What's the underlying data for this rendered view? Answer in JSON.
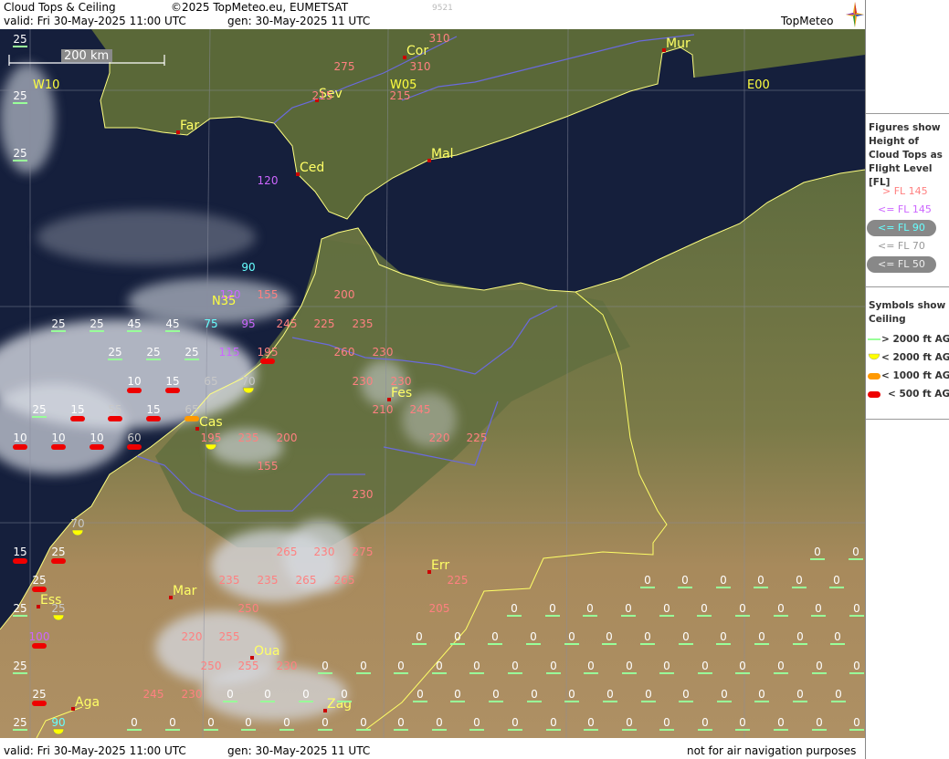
{
  "header": {
    "title": "Cloud Tops & Ceiling",
    "copyright": "©2025 TopMeteo.eu, EUMETSAT",
    "code": "9521",
    "valid": "valid:  Fri  30-May-2025  11:00 UTC",
    "gen": "gen: 30-May-2025 11 UTC",
    "logo": "TopMeteo"
  },
  "footer": {
    "valid": "valid:  Fri  30-May-2025  11:00 UTC",
    "gen": "gen: 30-May-2025 11 UTC",
    "disclaimer": "not for air navigation purposes"
  },
  "scale_label": "200 km",
  "grid_labels": {
    "w10": "W10",
    "w05": "W05",
    "e00": "E00",
    "n35": "N35"
  },
  "legend": {
    "figures_title": "Figures show Height of Cloud Tops as Flight Level [FL]",
    "items": [
      {
        "label": "> FL 145",
        "color": "#ff8080",
        "pill": false
      },
      {
        "label": "<= FL 145",
        "color": "#cc66ff",
        "pill": false
      },
      {
        "label": "<= FL 90",
        "color": "#66ffff",
        "pill": true
      },
      {
        "label": "<= FL 70",
        "color": "#999999",
        "pill": false
      },
      {
        "label": "<= FL 50",
        "color": "#eeeeee",
        "pill": true
      }
    ],
    "symbols_title": "Symbols show Ceiling",
    "symbols": [
      {
        "label": "> 2000 ft AGL",
        "type": "line",
        "color": "#99ff99"
      },
      {
        "label": "< 2000 ft AGL",
        "type": "half",
        "color": "#ffff00"
      },
      {
        "label": "< 1000 ft AGL",
        "type": "bar",
        "color": "#ff9900"
      },
      {
        "label": "< 500 ft AGL",
        "type": "bar",
        "color": "#ee0000"
      }
    ]
  },
  "colors": {
    "sea": "#141e3a",
    "land_n": "#5d6a3c",
    "land_s": "#a88a5c",
    "coast": "#ffff80",
    "border": "#ffff66",
    "river": "#6a6adc"
  },
  "cities": [
    {
      "name": "Cor"
    },
    {
      "name": "Mur"
    },
    {
      "name": "Sev"
    },
    {
      "name": "Far"
    },
    {
      "name": "Mal"
    },
    {
      "name": "Ced"
    },
    {
      "name": "Fes"
    },
    {
      "name": "Cas"
    },
    {
      "name": "Err"
    },
    {
      "name": "Mar"
    },
    {
      "name": "Ess"
    },
    {
      "name": "Oua"
    },
    {
      "name": "Aga"
    },
    {
      "name": "Zag"
    }
  ],
  "readings": [
    {
      "v": "25",
      "c": "green"
    },
    {
      "v": "25",
      "c": "green"
    },
    {
      "v": "25",
      "c": "green"
    },
    {
      "v": "310",
      "c": "pink"
    },
    {
      "v": "275",
      "c": "pink"
    },
    {
      "v": "310",
      "c": "pink"
    },
    {
      "v": "215",
      "c": "pink"
    },
    {
      "v": "215",
      "c": "pink"
    },
    {
      "v": "120",
      "c": "purple"
    },
    {
      "v": "90",
      "c": "cyan"
    },
    {
      "v": "120",
      "c": "purple"
    },
    {
      "v": "155",
      "c": "pink"
    },
    {
      "v": "200",
      "c": "pink"
    },
    {
      "v": "25",
      "c": "green"
    },
    {
      "v": "25",
      "c": "green"
    },
    {
      "v": "45",
      "c": "green"
    },
    {
      "v": "45",
      "c": "green"
    },
    {
      "v": "75",
      "c": "cyan"
    },
    {
      "v": "95",
      "c": "purple"
    },
    {
      "v": "245",
      "c": "pink"
    },
    {
      "v": "225",
      "c": "pink"
    },
    {
      "v": "235",
      "c": "pink"
    },
    {
      "v": "25",
      "c": "green"
    },
    {
      "v": "25",
      "c": "green"
    },
    {
      "v": "25",
      "c": "green"
    },
    {
      "v": "115",
      "c": "purple"
    },
    {
      "v": "195",
      "c": "pink",
      "s": "red"
    },
    {
      "v": "260",
      "c": "pink"
    },
    {
      "v": "230",
      "c": "pink"
    },
    {
      "v": "10",
      "c": "red",
      "s": "red"
    },
    {
      "v": "15",
      "c": "red",
      "s": "red"
    },
    {
      "v": "65",
      "c": "gray"
    },
    {
      "v": "70",
      "c": "gray",
      "s": "yellow"
    },
    {
      "v": "230",
      "c": "pink"
    },
    {
      "v": "230",
      "c": "pink"
    },
    {
      "v": "25",
      "c": "green"
    },
    {
      "v": "15",
      "c": "red",
      "s": "red"
    },
    {
      "v": "55",
      "c": "gray",
      "s": "red"
    },
    {
      "v": "15",
      "c": "red",
      "s": "red"
    },
    {
      "v": "65",
      "c": "gray",
      "s": "orange"
    },
    {
      "v": "210",
      "c": "pink"
    },
    {
      "v": "245",
      "c": "pink"
    },
    {
      "v": "10",
      "c": "red",
      "s": "red"
    },
    {
      "v": "10",
      "c": "red",
      "s": "red"
    },
    {
      "v": "10",
      "c": "red",
      "s": "red"
    },
    {
      "v": "60",
      "c": "gray",
      "s": "red"
    },
    {
      "v": "195",
      "c": "pink",
      "s": "yellow"
    },
    {
      "v": "235",
      "c": "pink"
    },
    {
      "v": "200",
      "c": "pink"
    },
    {
      "v": "220",
      "c": "pink"
    },
    {
      "v": "225",
      "c": "pink"
    },
    {
      "v": "155",
      "c": "pink"
    },
    {
      "v": "230",
      "c": "pink"
    },
    {
      "v": "70",
      "c": "gray",
      "s": "yellow"
    },
    {
      "v": "15",
      "c": "red",
      "s": "red"
    },
    {
      "v": "25",
      "c": "red",
      "s": "red"
    },
    {
      "v": "265",
      "c": "pink"
    },
    {
      "v": "230",
      "c": "pink"
    },
    {
      "v": "275",
      "c": "pink"
    },
    {
      "v": "25",
      "c": "red",
      "s": "red"
    },
    {
      "v": "235",
      "c": "pink"
    },
    {
      "v": "235",
      "c": "pink"
    },
    {
      "v": "265",
      "c": "pink"
    },
    {
      "v": "265",
      "c": "pink"
    },
    {
      "v": "225",
      "c": "pink"
    },
    {
      "v": "25",
      "c": "green"
    },
    {
      "v": "25",
      "c": "gray",
      "s": "yellow"
    },
    {
      "v": "250",
      "c": "pink"
    },
    {
      "v": "205",
      "c": "pink"
    },
    {
      "v": "100",
      "c": "purple",
      "s": "red"
    },
    {
      "v": "220",
      "c": "pink"
    },
    {
      "v": "255",
      "c": "pink"
    },
    {
      "v": "25",
      "c": "green"
    },
    {
      "v": "25",
      "c": "red",
      "s": "red"
    },
    {
      "v": "250",
      "c": "pink"
    },
    {
      "v": "255",
      "c": "pink"
    },
    {
      "v": "230",
      "c": "pink"
    },
    {
      "v": "245",
      "c": "pink"
    },
    {
      "v": "230",
      "c": "pink"
    },
    {
      "v": "25",
      "c": "green"
    },
    {
      "v": "90",
      "c": "cyan",
      "s": "yellow"
    },
    {
      "v": "0",
      "c": "white"
    }
  ]
}
